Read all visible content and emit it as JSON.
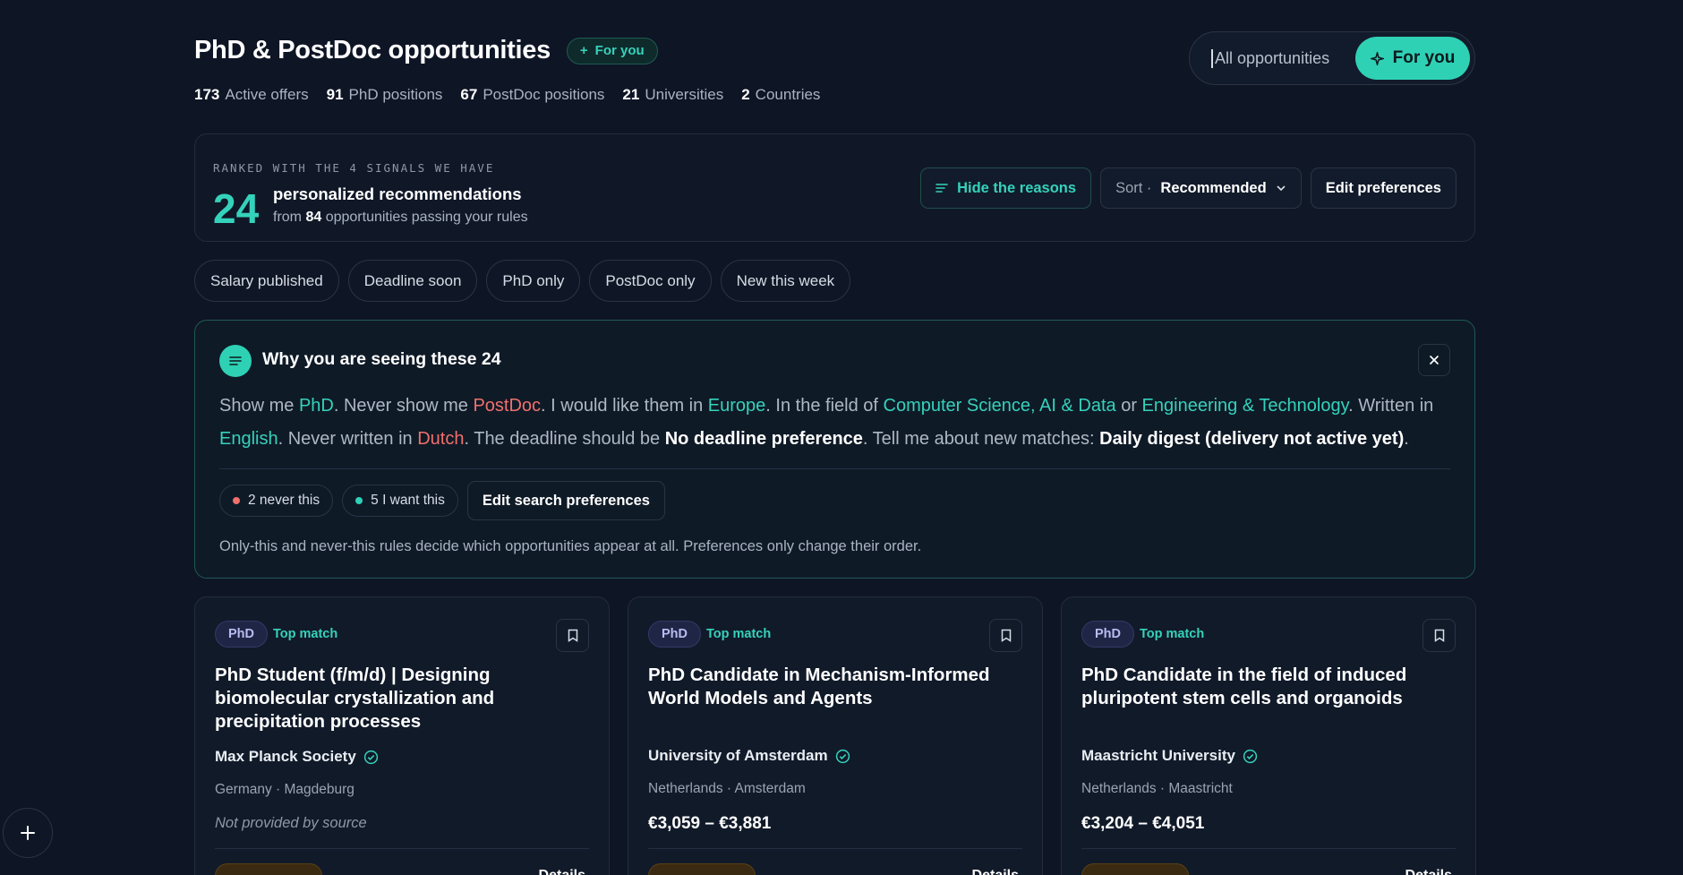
{
  "header": {
    "title": "PhD & PostDoc opportunities",
    "badge": "For you",
    "stats": [
      {
        "value": "173",
        "label": "Active offers"
      },
      {
        "value": "91",
        "label": "PhD positions"
      },
      {
        "value": "67",
        "label": "PostDoc positions"
      },
      {
        "value": "21",
        "label": "Universities"
      },
      {
        "value": "2",
        "label": "Countries"
      }
    ],
    "toggle": {
      "all": "All opportunities",
      "for_you": "For you"
    }
  },
  "ranked": {
    "caption": "RANKED WITH THE 4 SIGNALS WE HAVE",
    "count": "24",
    "line1": "personalized recommendations",
    "line2_prefix": "from",
    "line2_count": "84",
    "line2_suffix": "opportunities passing your rules",
    "hide_reasons": "Hide the reasons",
    "sort_label": "Sort ·",
    "sort_value": "Recommended",
    "edit_prefs": "Edit preferences"
  },
  "filters": [
    "Salary published",
    "Deadline soon",
    "PhD only",
    "PostDoc only",
    "New this week"
  ],
  "why": {
    "title": "Why you are seeing these 24",
    "s": [
      "Show me ",
      "PhD",
      ". Never show me ",
      "PostDoc",
      ". I would like them in ",
      "Europe",
      ". In the field of ",
      "Computer Science, AI & Data",
      " or ",
      "Engineering & Technology",
      ". Written in ",
      "English",
      ". Never written in ",
      "Dutch",
      ". The deadline should be ",
      "No deadline preference",
      ". Tell me about new matches: ",
      "Daily digest (delivery not active yet)",
      "."
    ],
    "never_tag": "2 never this",
    "want_tag": "5 I want this",
    "edit_search": "Edit search preferences",
    "note": "Only-this and never-this rules decide which opportunities appear at all. Preferences only change their order."
  },
  "cards": [
    {
      "type": "PhD",
      "match": "Top match",
      "title": "PhD Student (f/m/d) | Designing biomolecular crystallization and precipitation processes",
      "org": "Max Planck Society",
      "location": "Germany · Magdeburg",
      "salary": "Not provided by source",
      "details": "Details"
    },
    {
      "type": "PhD",
      "match": "Top match",
      "title": "PhD Candidate in Mechanism-Informed World Models and Agents",
      "org": "University of Amsterdam",
      "location": "Netherlands · Amsterdam",
      "salary": "€3,059 – €3,881",
      "details": "Details"
    },
    {
      "type": "PhD",
      "match": "Top match",
      "title": "PhD Candidate in the field of induced pluripotent stem cells and organoids",
      "org": "Maastricht University",
      "location": "Netherlands · Maastricht",
      "salary": "€3,204 – €4,051",
      "details": "Details"
    }
  ],
  "colors": {
    "accent": "#2fd1b5",
    "negative": "#f0706c",
    "background": "#0e1525"
  }
}
